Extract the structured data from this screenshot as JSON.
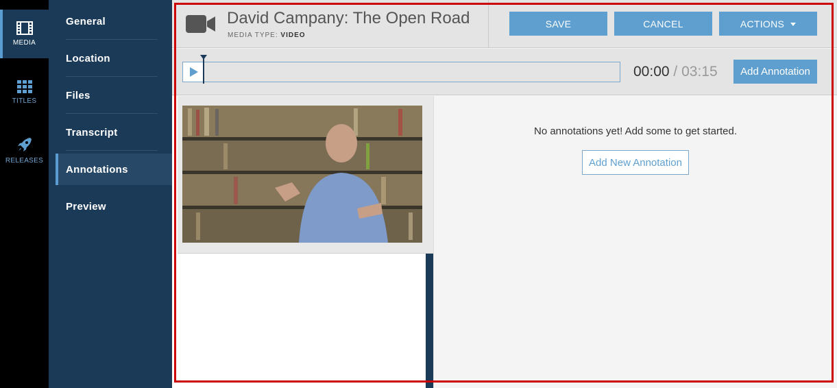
{
  "rail": {
    "items": [
      {
        "label": "MEDIA",
        "icon": "film-icon"
      },
      {
        "label": "TITLES",
        "icon": "grid-icon"
      },
      {
        "label": "RELEASES",
        "icon": "rocket-icon"
      }
    ]
  },
  "sidebar": {
    "items": [
      {
        "label": "General"
      },
      {
        "label": "Location"
      },
      {
        "label": "Files"
      },
      {
        "label": "Transcript"
      },
      {
        "label": "Annotations",
        "active": true
      },
      {
        "label": "Preview"
      }
    ]
  },
  "header": {
    "title": "David Campany: The Open Road",
    "media_type_label": "MEDIA TYPE:",
    "media_type_value": "VIDEO",
    "save_label": "SAVE",
    "cancel_label": "CANCEL",
    "actions_label": "ACTIONS"
  },
  "player": {
    "current_time": "00:00",
    "separator": "/",
    "duration": "03:15",
    "add_annotation_label": "Add Annotation",
    "progress": 0
  },
  "annotations": {
    "empty_message": "No annotations yet! Add some to get started.",
    "add_new_label": "Add New Annotation"
  },
  "colors": {
    "accent": "#5f9fcf",
    "navy": "#1a3a57",
    "highlight_border": "#cc0000"
  }
}
